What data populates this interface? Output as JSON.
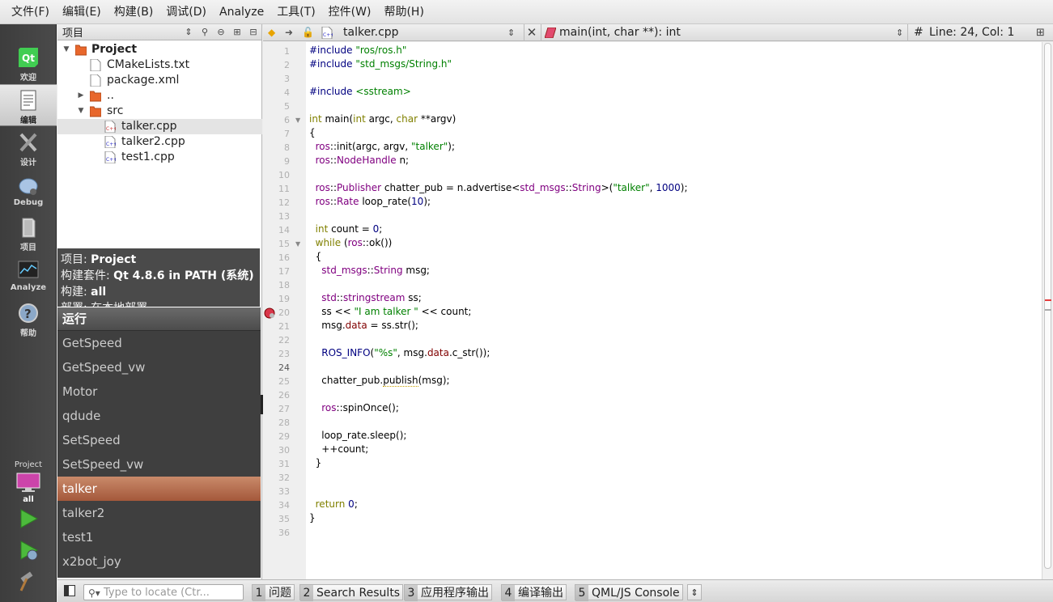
{
  "menubar": [
    "文件(F)",
    "编辑(E)",
    "构建(B)",
    "调试(D)",
    "Analyze",
    "工具(T)",
    "控件(W)",
    "帮助(H)"
  ],
  "modes": [
    {
      "label": "欢迎",
      "icon": "qt-logo-icon"
    },
    {
      "label": "编辑",
      "icon": "document-edit-icon"
    },
    {
      "label": "设计",
      "icon": "design-tools-icon"
    },
    {
      "label": "Debug",
      "icon": "debug-bug-icon"
    },
    {
      "label": "项目",
      "icon": "project-book-icon"
    },
    {
      "label": "Analyze",
      "icon": "analyze-monitor-icon"
    },
    {
      "label": "帮助",
      "icon": "help-icon"
    }
  ],
  "kit": {
    "project_label": "Project",
    "build_label": "all"
  },
  "projects_pane": {
    "title": "项目",
    "tree": [
      {
        "text": "Project",
        "bold": true,
        "icon": "folder-icon"
      },
      {
        "text": "CMakeLists.txt",
        "icon": "file-icon"
      },
      {
        "text": "package.xml",
        "icon": "file-icon"
      },
      {
        "text": "..",
        "icon": "folder-icon"
      },
      {
        "text": "src",
        "icon": "folder-icon"
      },
      {
        "text": "talker.cpp",
        "icon": "cpp-file-icon"
      },
      {
        "text": "talker2.cpp",
        "icon": "cpp-file-icon"
      },
      {
        "text": "test1.cpp",
        "icon": "cpp-file-icon"
      }
    ]
  },
  "info": {
    "project_key": "项目:",
    "project_val": "Project",
    "kit_key": "构建套件:",
    "kit_val": "Qt 4.8.6 in PATH (系统)",
    "build_key": "构建:",
    "build_val": "all",
    "deploy_partial": "部署: 在本地部署"
  },
  "run_popup": {
    "header": "运行",
    "items": [
      "GetSpeed",
      "GetSpeed_vw",
      "Motor",
      "qdude",
      "SetSpeed",
      "SetSpeed_vw",
      "talker",
      "talker2",
      "test1",
      "x2bot_joy"
    ],
    "selected": "talker"
  },
  "editor": {
    "file": "talker.cpp",
    "symbol": "main(int, char **): int",
    "hash": "#",
    "position": "Line: 24, Col: 1",
    "current_line": 24
  },
  "status": {
    "locate_placeholder": "Type to locate (Ctr...",
    "panes": [
      {
        "num": "1",
        "label": "问题"
      },
      {
        "num": "2",
        "label": "Search Results"
      },
      {
        "num": "3",
        "label": "应用程序输出"
      },
      {
        "num": "4",
        "label": "编译输出"
      },
      {
        "num": "5",
        "label": "QML/JS Console"
      }
    ]
  }
}
